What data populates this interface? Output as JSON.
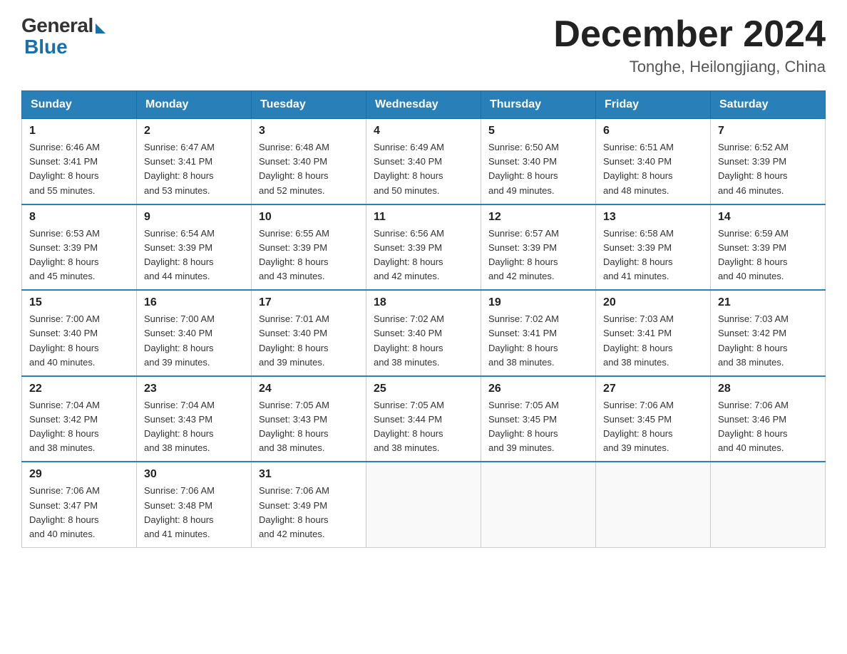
{
  "header": {
    "logo_general": "General",
    "logo_blue": "Blue",
    "month_title": "December 2024",
    "location": "Tonghe, Heilongjiang, China"
  },
  "days_of_week": [
    "Sunday",
    "Monday",
    "Tuesday",
    "Wednesday",
    "Thursday",
    "Friday",
    "Saturday"
  ],
  "weeks": [
    [
      {
        "day": "1",
        "sunrise": "6:46 AM",
        "sunset": "3:41 PM",
        "daylight": "8 hours and 55 minutes."
      },
      {
        "day": "2",
        "sunrise": "6:47 AM",
        "sunset": "3:41 PM",
        "daylight": "8 hours and 53 minutes."
      },
      {
        "day": "3",
        "sunrise": "6:48 AM",
        "sunset": "3:40 PM",
        "daylight": "8 hours and 52 minutes."
      },
      {
        "day": "4",
        "sunrise": "6:49 AM",
        "sunset": "3:40 PM",
        "daylight": "8 hours and 50 minutes."
      },
      {
        "day": "5",
        "sunrise": "6:50 AM",
        "sunset": "3:40 PM",
        "daylight": "8 hours and 49 minutes."
      },
      {
        "day": "6",
        "sunrise": "6:51 AM",
        "sunset": "3:40 PM",
        "daylight": "8 hours and 48 minutes."
      },
      {
        "day": "7",
        "sunrise": "6:52 AM",
        "sunset": "3:39 PM",
        "daylight": "8 hours and 46 minutes."
      }
    ],
    [
      {
        "day": "8",
        "sunrise": "6:53 AM",
        "sunset": "3:39 PM",
        "daylight": "8 hours and 45 minutes."
      },
      {
        "day": "9",
        "sunrise": "6:54 AM",
        "sunset": "3:39 PM",
        "daylight": "8 hours and 44 minutes."
      },
      {
        "day": "10",
        "sunrise": "6:55 AM",
        "sunset": "3:39 PM",
        "daylight": "8 hours and 43 minutes."
      },
      {
        "day": "11",
        "sunrise": "6:56 AM",
        "sunset": "3:39 PM",
        "daylight": "8 hours and 42 minutes."
      },
      {
        "day": "12",
        "sunrise": "6:57 AM",
        "sunset": "3:39 PM",
        "daylight": "8 hours and 42 minutes."
      },
      {
        "day": "13",
        "sunrise": "6:58 AM",
        "sunset": "3:39 PM",
        "daylight": "8 hours and 41 minutes."
      },
      {
        "day": "14",
        "sunrise": "6:59 AM",
        "sunset": "3:39 PM",
        "daylight": "8 hours and 40 minutes."
      }
    ],
    [
      {
        "day": "15",
        "sunrise": "7:00 AM",
        "sunset": "3:40 PM",
        "daylight": "8 hours and 40 minutes."
      },
      {
        "day": "16",
        "sunrise": "7:00 AM",
        "sunset": "3:40 PM",
        "daylight": "8 hours and 39 minutes."
      },
      {
        "day": "17",
        "sunrise": "7:01 AM",
        "sunset": "3:40 PM",
        "daylight": "8 hours and 39 minutes."
      },
      {
        "day": "18",
        "sunrise": "7:02 AM",
        "sunset": "3:40 PM",
        "daylight": "8 hours and 38 minutes."
      },
      {
        "day": "19",
        "sunrise": "7:02 AM",
        "sunset": "3:41 PM",
        "daylight": "8 hours and 38 minutes."
      },
      {
        "day": "20",
        "sunrise": "7:03 AM",
        "sunset": "3:41 PM",
        "daylight": "8 hours and 38 minutes."
      },
      {
        "day": "21",
        "sunrise": "7:03 AM",
        "sunset": "3:42 PM",
        "daylight": "8 hours and 38 minutes."
      }
    ],
    [
      {
        "day": "22",
        "sunrise": "7:04 AM",
        "sunset": "3:42 PM",
        "daylight": "8 hours and 38 minutes."
      },
      {
        "day": "23",
        "sunrise": "7:04 AM",
        "sunset": "3:43 PM",
        "daylight": "8 hours and 38 minutes."
      },
      {
        "day": "24",
        "sunrise": "7:05 AM",
        "sunset": "3:43 PM",
        "daylight": "8 hours and 38 minutes."
      },
      {
        "day": "25",
        "sunrise": "7:05 AM",
        "sunset": "3:44 PM",
        "daylight": "8 hours and 38 minutes."
      },
      {
        "day": "26",
        "sunrise": "7:05 AM",
        "sunset": "3:45 PM",
        "daylight": "8 hours and 39 minutes."
      },
      {
        "day": "27",
        "sunrise": "7:06 AM",
        "sunset": "3:45 PM",
        "daylight": "8 hours and 39 minutes."
      },
      {
        "day": "28",
        "sunrise": "7:06 AM",
        "sunset": "3:46 PM",
        "daylight": "8 hours and 40 minutes."
      }
    ],
    [
      {
        "day": "29",
        "sunrise": "7:06 AM",
        "sunset": "3:47 PM",
        "daylight": "8 hours and 40 minutes."
      },
      {
        "day": "30",
        "sunrise": "7:06 AM",
        "sunset": "3:48 PM",
        "daylight": "8 hours and 41 minutes."
      },
      {
        "day": "31",
        "sunrise": "7:06 AM",
        "sunset": "3:49 PM",
        "daylight": "8 hours and 42 minutes."
      },
      null,
      null,
      null,
      null
    ]
  ],
  "labels": {
    "sunrise_prefix": "Sunrise: ",
    "sunset_prefix": "Sunset: ",
    "daylight_prefix": "Daylight: "
  }
}
